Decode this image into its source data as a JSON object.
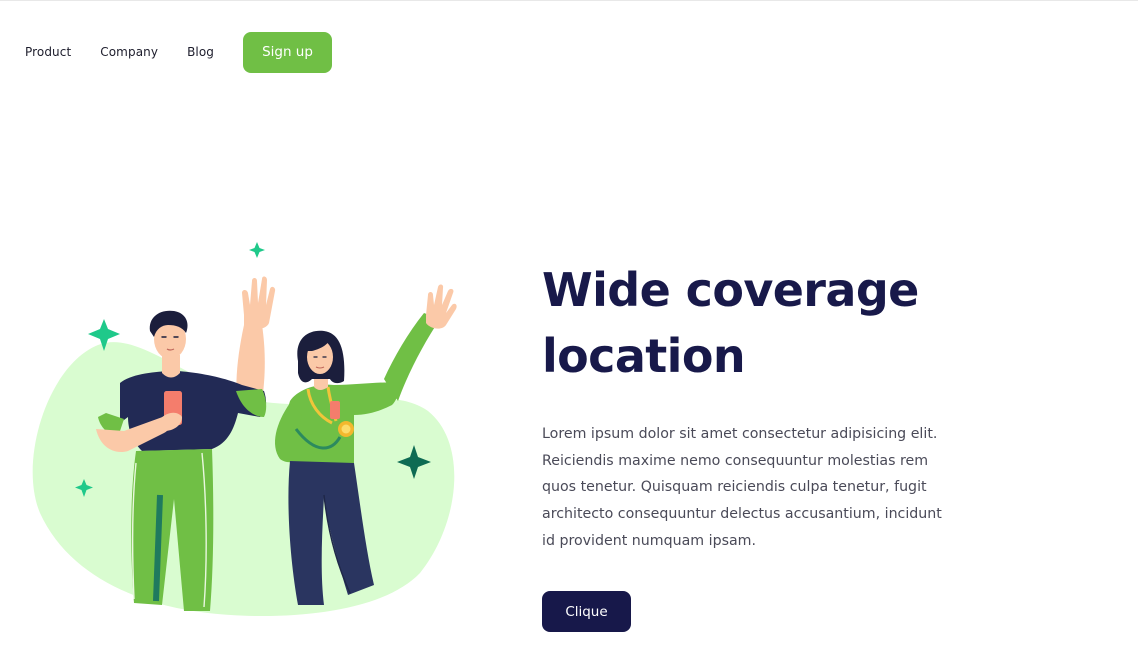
{
  "nav": {
    "links": [
      "Product",
      "Company",
      "Blog"
    ],
    "signup_label": "Sign up"
  },
  "hero": {
    "title_line1": "Wide coverage",
    "title_line2": "location",
    "body": "Lorem ipsum dolor sit amet consectetur adipisicing elit. Reiciendis maxime nemo consequuntur molestias rem quos tenetur. Quisquam reiciendis culpa tenetur, fugit architecto consequuntur delectus accusantium, incidunt id provident numquam ipsam.",
    "cta_label": "Clique"
  },
  "colors": {
    "accent_green": "#70bf45",
    "navy": "#17184a",
    "blob": "#d9fcd0",
    "sparkle_green": "#1fc98a",
    "sparkle_dark": "#0e6b53"
  },
  "illustration": {
    "icons": [
      "sparkle-icon",
      "person-man-waving",
      "person-woman-waving",
      "smartphone-icon",
      "medal-icon"
    ]
  }
}
